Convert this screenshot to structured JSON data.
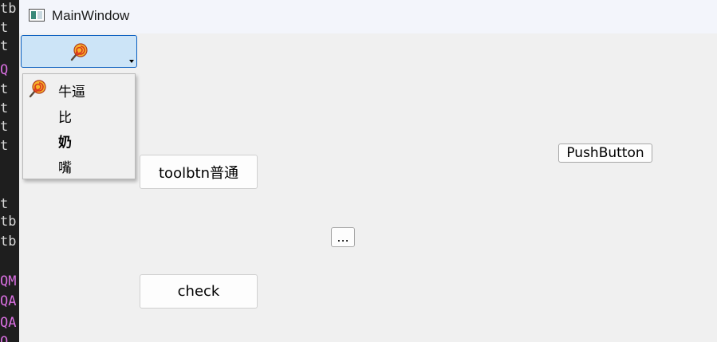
{
  "terminal": {
    "lines": [
      {
        "text": "tb",
        "highlight": false
      },
      {
        "text": " t",
        "highlight": false
      },
      {
        "text": " t",
        "highlight": false
      },
      {
        "text": " Q",
        "highlight": true
      },
      {
        "text": " t",
        "highlight": false
      },
      {
        "text": " t",
        "highlight": false
      },
      {
        "text": " t",
        "highlight": false
      },
      {
        "text": " t",
        "highlight": false
      },
      {
        "text": " t",
        "highlight": false
      },
      {
        "text": "tb",
        "highlight": false
      },
      {
        "text": "tb",
        "highlight": false
      },
      {
        "text": "QM",
        "highlight": true
      },
      {
        "text": "QA",
        "highlight": true
      },
      {
        "text": "QA",
        "highlight": true
      },
      {
        "text": "Q",
        "highlight": true
      }
    ]
  },
  "window": {
    "title": "MainWindow"
  },
  "tool_menu_button": {
    "icon": "lollipop-icon"
  },
  "popup_menu": {
    "items": [
      {
        "label": "牛逼",
        "icon": "lollipop-icon",
        "bold": false
      },
      {
        "label": "比",
        "icon": "",
        "bold": false
      },
      {
        "label": "奶",
        "icon": "",
        "bold": true
      },
      {
        "label": "嘴",
        "icon": "",
        "bold": false
      }
    ]
  },
  "buttons": {
    "toolbtn_normal": "toolbtn普通",
    "push_button": "PushButton",
    "ellipsis": "...",
    "check": "check"
  },
  "colors": {
    "window_bg": "#f0f0f0",
    "titlebar_bg": "#f3f5fb",
    "active_button_bg": "#cce4f7",
    "active_button_border": "#0b5fc0"
  }
}
